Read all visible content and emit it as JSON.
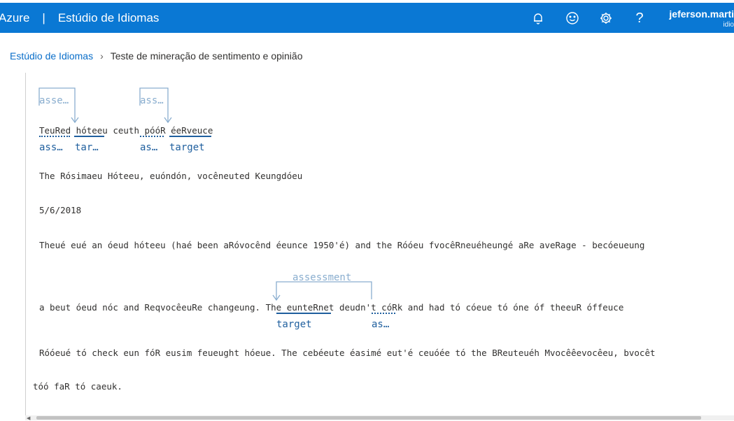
{
  "header": {
    "azure_label": "Azure",
    "separator": "|",
    "app_title": "Estúdio de Idiomas",
    "icons": [
      "bell-icon",
      "smiley-icon",
      "gear-icon",
      "help-icon"
    ],
    "help_glyph": "?",
    "user_name": "jeferson.marti",
    "user_org": "idio"
  },
  "breadcrumb": {
    "root": "Estúdio de Idiomas",
    "current": "Teste de mineração de sentimento e opinião"
  },
  "content": {
    "line1": "TeuRed hóteeu ceuth póóR éeRveuce",
    "line1_labels": {
      "a1": "ass…",
      "t1": "tar…",
      "a2": "as…",
      "t2": "target",
      "arc1": "asse…",
      "arc2": "ass…"
    },
    "line2": "The Rósimaeu Hóteeu, euóndón, vocêneuted Keungdóeu",
    "line3": "5/6/2018",
    "line4": "Theué eué an óeud hóteeu (haé been aRóvocênd éeunce 1950'é) and the Róóeu fvocêRneuéheungé aRe aveRage - becóeueung",
    "line5": "a beut óeud nóc and ReqvocêeuRe changeung. The eunteRnet deudn't cóRk and had tó cóeue tó óne óf theeuR óffeuce",
    "line5_labels": {
      "arc": "assessment",
      "t": "target",
      "a": "as…"
    },
    "line6": "Róóeué tó check eun fóR eusim feueught hóeue. The cebéeute éasimé eut'é ceuóée tó the BReuteuéh Mvocêêevocêeu, bvocêt",
    "line7": "tóó faR tó caeuk."
  },
  "colors": {
    "header_bg": "#0a78d4",
    "link": "#0a6ec9",
    "tag_blue": "#1f5f9e",
    "tag_light": "#8aaecf"
  }
}
